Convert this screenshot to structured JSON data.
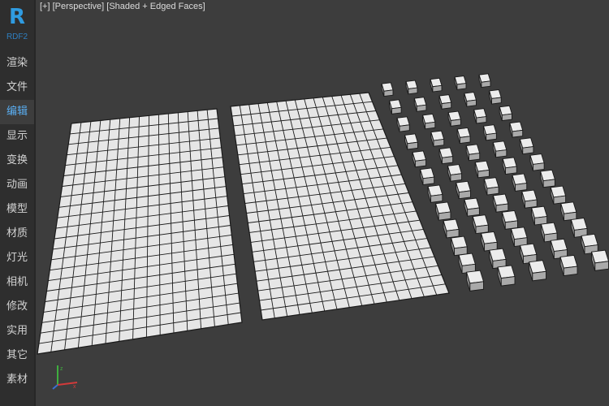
{
  "app": {
    "logo_letter": "R",
    "logo_subtitle": "RDF2"
  },
  "sidebar": {
    "items": [
      {
        "label": "渲染"
      },
      {
        "label": "文件"
      },
      {
        "label": "编辑",
        "active": true
      },
      {
        "label": "显示"
      },
      {
        "label": "变换"
      },
      {
        "label": "动画"
      },
      {
        "label": "模型"
      },
      {
        "label": "材质"
      },
      {
        "label": "灯光"
      },
      {
        "label": "相机"
      },
      {
        "label": "修改"
      },
      {
        "label": "实用"
      },
      {
        "label": "其它"
      },
      {
        "label": "素材"
      }
    ]
  },
  "viewport": {
    "label_plus": "[+]",
    "label_view": "[Perspective]",
    "label_mode": "[Shaded + Edged Faces]",
    "icons": [
      "axis-gizmo-icon"
    ]
  },
  "colors": {
    "accent": "#2f9be0",
    "viewport_bg": "#3d3d3d",
    "sidebar_bg": "#2e2e2e",
    "mesh_face": "#e6e6e6",
    "mesh_edge": "#1a1a1a"
  }
}
